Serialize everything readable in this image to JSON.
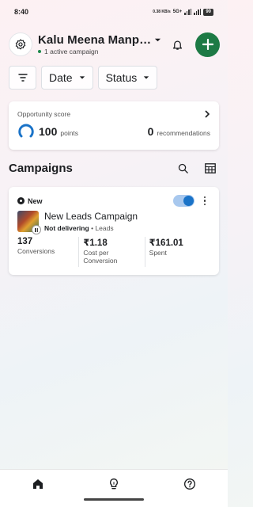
{
  "status_bar": {
    "time": "8:40",
    "data_speed": "0.38 KB/s",
    "network": "5G+",
    "battery": "90"
  },
  "header": {
    "account_name": "Kalu Meena Manp…",
    "active_campaigns": "1 active campaign",
    "icons": [
      "settings-gear-icon",
      "chevron-down-icon",
      "bell-icon",
      "plus-icon"
    ],
    "fab_color": "#1d7a45"
  },
  "filters": {
    "icon": "filter-icon",
    "date_label": "Date",
    "status_label": "Status"
  },
  "opportunity": {
    "title": "Opportunity score",
    "score": "100",
    "score_unit": "points",
    "score_fraction": 1.0,
    "recommendations_count": "0",
    "recommendations_label": "recommendations"
  },
  "campaigns": {
    "title": "Campaigns",
    "icons": [
      "search-icon",
      "table-icon"
    ]
  },
  "campaign": {
    "badge": "New",
    "name": "New Leads Campaign",
    "status": "Not delivering",
    "objective": "Leads",
    "toggle_on": true,
    "accent_color": "#1a73c8",
    "metrics": [
      {
        "value": "137",
        "label": "Conversions"
      },
      {
        "value": "₹1.18",
        "label": "Cost per Conversion"
      },
      {
        "value": "₹161.01",
        "label": "Spent"
      }
    ]
  },
  "bottom_nav": {
    "items": [
      "home-icon",
      "lightbulb-icon",
      "help-icon"
    ]
  }
}
